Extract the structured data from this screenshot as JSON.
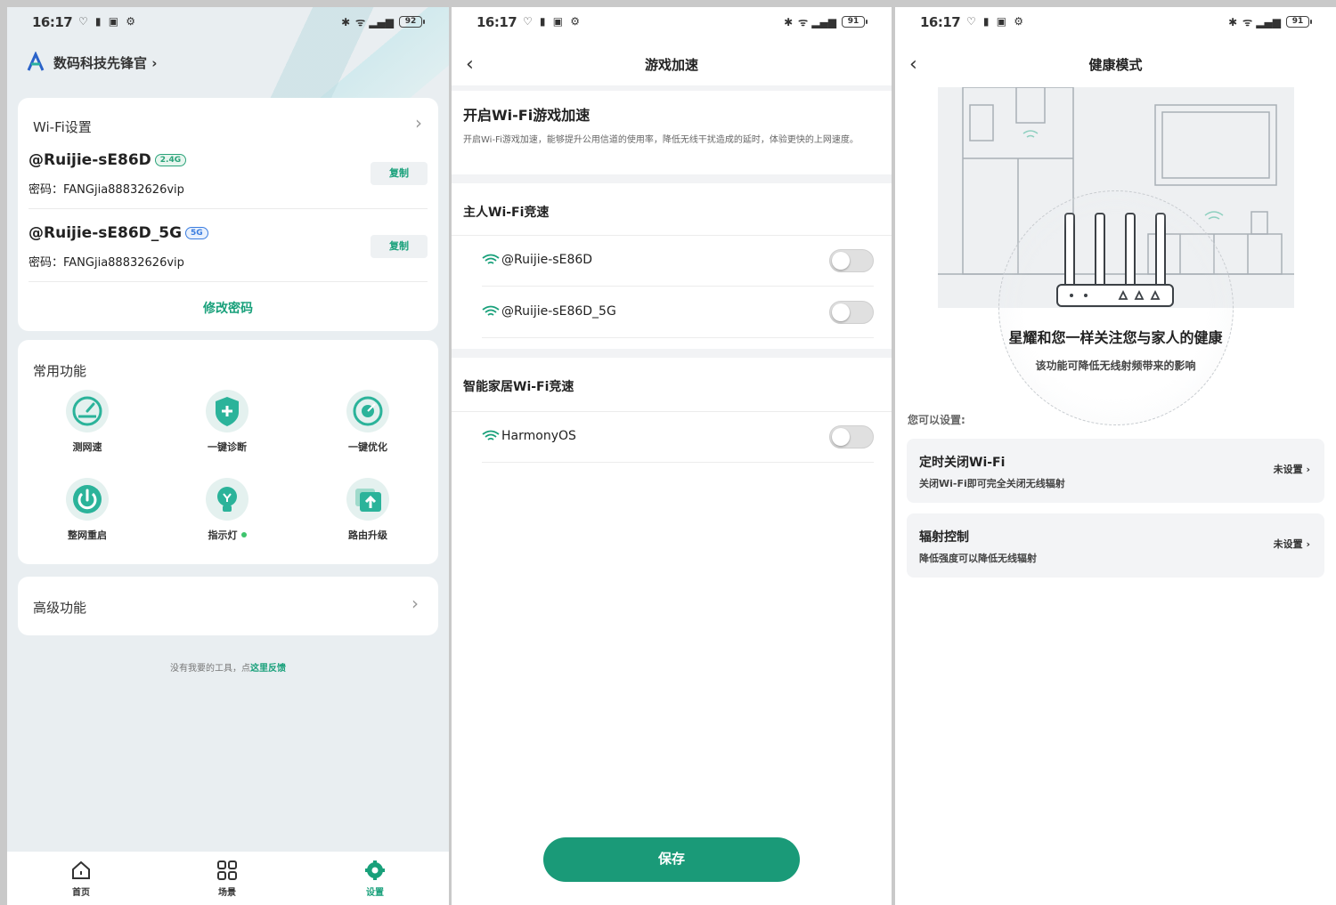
{
  "status": {
    "time": "16:17",
    "battery_1": "92",
    "battery_2": "91",
    "battery_3": "91"
  },
  "screen1": {
    "brand": "数码科技先锋官 ›",
    "wifi": {
      "title": "Wi-Fi设置",
      "networks": [
        {
          "ssid": "@Ruijie-sE86D",
          "band": "2.4G",
          "password": "密码：FANGjia88832626vip",
          "copy": "复制"
        },
        {
          "ssid": "@Ruijie-sE86D_5G",
          "band": "5G",
          "password": "密码：FANGjia88832626vip",
          "copy": "复制"
        }
      ],
      "change_password": "修改密码"
    },
    "functions": {
      "title": "常用功能",
      "items": [
        {
          "label": "测网速",
          "icon": "speedometer-icon"
        },
        {
          "label": "一键诊断",
          "icon": "shield-plus-icon"
        },
        {
          "label": "一键优化",
          "icon": "optimize-icon"
        },
        {
          "label": "整网重启",
          "icon": "power-icon"
        },
        {
          "label": "指示灯",
          "icon": "bulb-icon"
        },
        {
          "label": "路由升级",
          "icon": "upgrade-icon"
        }
      ]
    },
    "advanced": "高级功能",
    "feedback_text": "没有我要的工具，点",
    "feedback_link": "这里反馈",
    "tabs": [
      "首页",
      "场景",
      "设置"
    ]
  },
  "screen2": {
    "title": "游戏加速",
    "enable_heading": "开启Wi-Fi游戏加速",
    "enable_desc": "开启Wi-Fi游戏加速，能够提升公用信道的使用率，降低无线干扰造成的延时，体验更快的上网速度。",
    "host_section": "主人Wi-Fi竞速",
    "host_networks": [
      "@Ruijie-sE86D",
      "@Ruijie-sE86D_5G"
    ],
    "smart_section": "智能家居Wi-Fi竞速",
    "smart_networks": [
      "HarmonyOS"
    ],
    "save": "保存"
  },
  "screen3": {
    "title": "健康模式",
    "headline": "星耀和您一样关注您与家人的健康",
    "subline": "该功能可降低无线射频带来的影响",
    "you_can": "您可以设置:",
    "settings": [
      {
        "title": "定时关闭Wi-Fi",
        "sub": "关闭Wi-Fi即可完全关闭无线辐射",
        "status": "未设置 ›"
      },
      {
        "title": "辐射控制",
        "sub": "降低强度可以降低无线辐射",
        "status": "未设置 ›"
      }
    ]
  },
  "colors": {
    "accent": "#18a07a",
    "save_button": "#1a9a78",
    "background_home": "#e9eef1"
  }
}
